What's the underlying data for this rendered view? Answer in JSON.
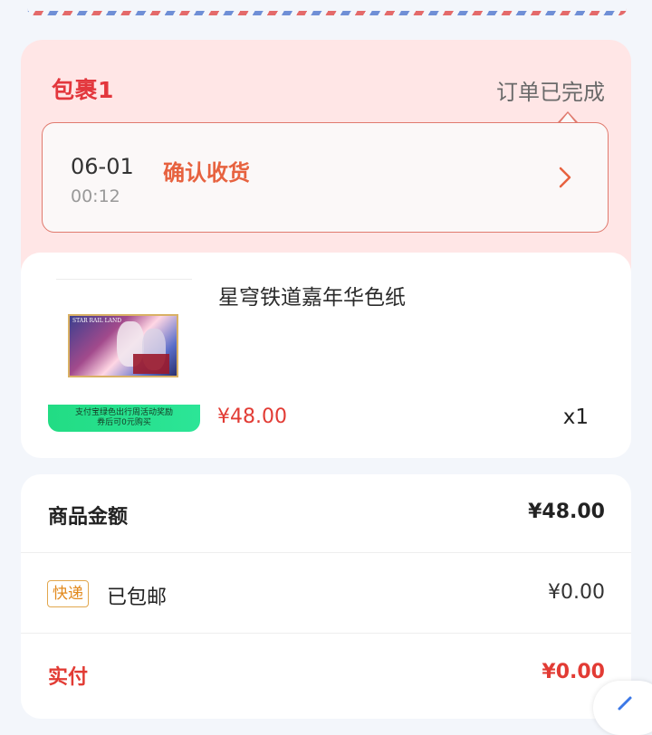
{
  "package": {
    "title": "包裹1",
    "status": "订单已完成",
    "tracking": {
      "date": "06-01",
      "time": "00:12",
      "action": "确认收货"
    }
  },
  "item": {
    "name": "星穹铁道嘉年华色纸",
    "price": "¥48.00",
    "quantity": "x1",
    "thumbnail_text": "STAR RAIL LAND",
    "promo_line1": "支付宝绿色出行周活动奖励",
    "promo_line2": "券后可0元购买"
  },
  "summary": {
    "goods_label": "商品金额",
    "goods_value": "¥48.00",
    "shipping_tag": "快递",
    "shipping_label": "已包邮",
    "shipping_value": "¥0.00",
    "paid_label": "实付",
    "paid_value": "¥0.00"
  },
  "colors": {
    "accent_red": "#e23b34",
    "action_orange": "#e7623f",
    "package_bg": "#ffe6e6",
    "promo_green": "#22dc84"
  },
  "icons": {
    "track_chevron": "chevron-right-icon",
    "float_button": "arrow-icon"
  }
}
